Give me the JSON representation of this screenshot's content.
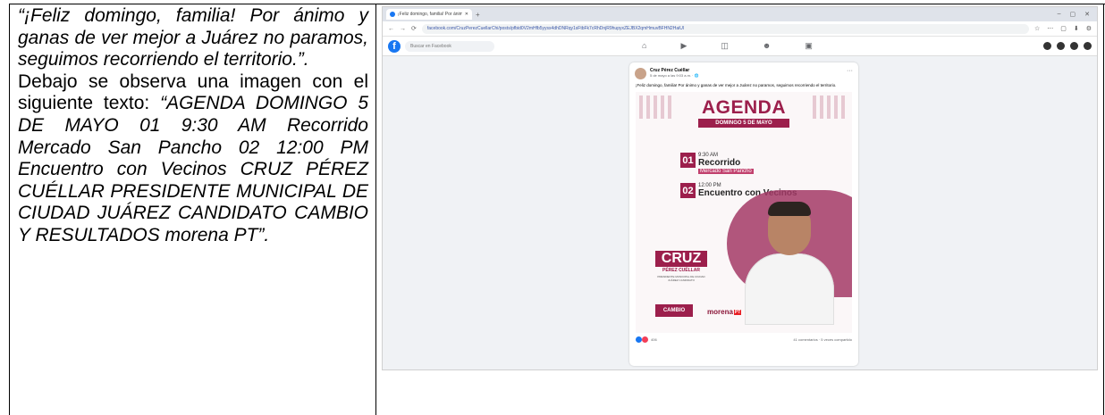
{
  "caption": {
    "quote_text": "“¡Feliz domingo, familia! Por ánimo y ganas de ver mejor a Juárez no paramos, seguimos recorriendo el territorio.”.",
    "intro_text": "Debajo se observa una imagen con el siguiente texto: ",
    "image_text_quote": "“AGENDA DOMINGO 5 DE MAYO 01 9:30 AM Recorrido Mercado San Pancho 02 12:00 PM Encuentro con Vecinos CRUZ PÉREZ CUÉLLAR PRESIDENTE MUNICIPAL DE CIUDAD JUÁREZ CANDIDATO CAMBIO Y RESULTADOS morena PT”."
  },
  "browser": {
    "tab_title": "¡Feliz domingo, familia! Por ánim",
    "new_tab": "+",
    "window_controls": [
      "–",
      "▢",
      "✕"
    ],
    "nav": [
      "←",
      "→",
      "⟳"
    ],
    "url": "facebook.com/CruzPerezCuellarChi/posts/pfbid0V2mHfb5yyss4dhDNRqy1sFtbFk7cRhDnjR9hupyxZEJBX2qmHmuvBFHN2HaiUl",
    "toolbar_icons": [
      "☆",
      "⋯",
      "▢",
      "⬇",
      "⚙"
    ]
  },
  "facebook": {
    "logo": "f",
    "search_placeholder": "Buscar en Facebook",
    "nav_icons": [
      "⌂",
      "▶",
      "◫",
      "☻",
      "▣"
    ],
    "post": {
      "author": "Cruz Pérez Cuéllar",
      "meta": "5 de mayo a las 9:03 a.m. · 🌐",
      "more": "···",
      "text": "¡Feliz domingo, familia! Por ánimo y ganas de ver mejor a Juárez no paramos, seguimos recorriendo el territorio.",
      "reactions_count": "406",
      "stats": "41 comentarios · 5 veces compartido"
    }
  },
  "flyer": {
    "title": "AGENDA",
    "date": "DOMINGO 5 DE MAYO",
    "items": [
      {
        "num": "01",
        "time": "9:30 AM",
        "what": "Recorrido",
        "where": "Mercado San Pancho"
      },
      {
        "num": "02",
        "time": "12:00 PM",
        "what": "Encuentro con Vecinos",
        "where": ""
      }
    ],
    "name_big": "CRUZ",
    "name_small": "PÉREZ CUÉLLAR",
    "cargo": "PRESIDENTE MUNICIPAL DE CIUDAD JUÁREZ CANDIDATO",
    "coalition": "CAMBIO",
    "party": "morena",
    "party2": "PT"
  },
  "colors": {
    "accent": "#9c1f4c",
    "facebook_blue": "#1877f2"
  }
}
